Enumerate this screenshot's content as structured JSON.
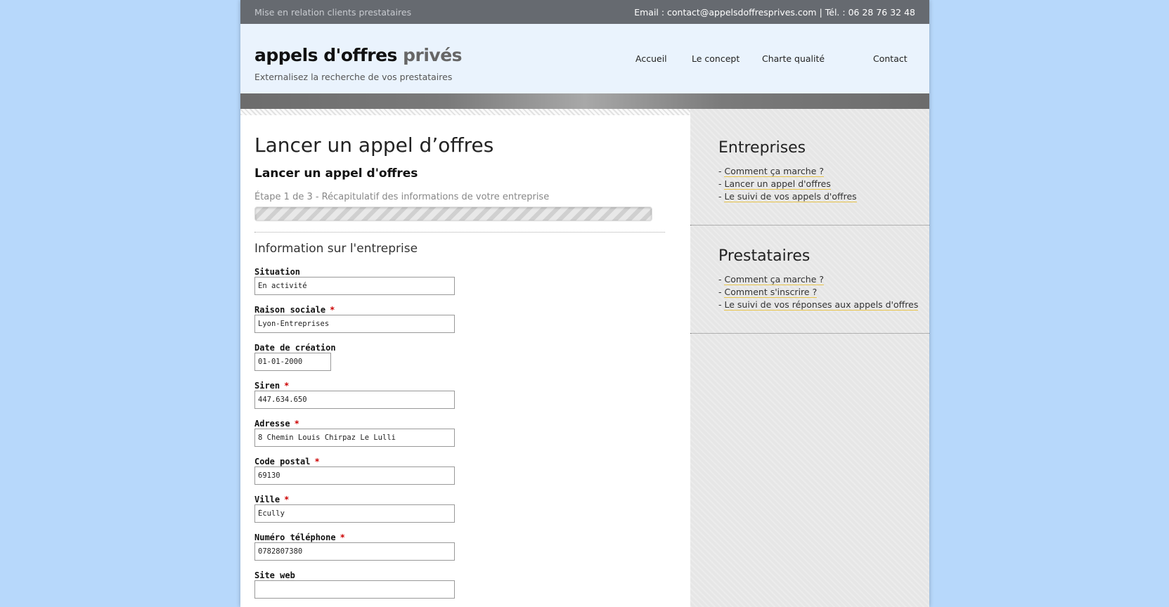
{
  "topbar": {
    "tagline": "Mise en relation clients prestataires",
    "contact": "Email : contact@appelsdoffresprives.com | Tél. : 06 28 76 32 48"
  },
  "header": {
    "logo_main": "appels d'offres",
    "logo_accent": "privés",
    "slogan": "Externalisez la recherche de vos prestataires",
    "nav": [
      "Accueil",
      "Le concept",
      "Charte qualité",
      "Contact"
    ]
  },
  "main": {
    "page_title": "Lancer un appel d’offres",
    "form_title": "Lancer un appel d'offres",
    "step_text": "Étape 1 de 3 - Récapitulatif des informations de votre entreprise",
    "section_title": "Information sur l'entreprise",
    "fields": [
      {
        "label": "Situation",
        "required": "",
        "value": "En activité"
      },
      {
        "label": "Raison sociale",
        "required": "*",
        "value": "Lyon-Entreprises"
      },
      {
        "label": "Date de création",
        "required": "",
        "value": "01-01-2000"
      },
      {
        "label": "Siren",
        "required": "*",
        "value": "447.634.650"
      },
      {
        "label": "Adresse",
        "required": "*",
        "value": "8 Chemin Louis Chirpaz Le Lulli"
      },
      {
        "label": "Code postal",
        "required": "*",
        "value": "69130"
      },
      {
        "label": "Ville",
        "required": "*",
        "value": "Écully"
      },
      {
        "label": "Numéro téléphone",
        "required": "*",
        "value": "0782807380"
      },
      {
        "label": "Site web",
        "required": "",
        "value": ""
      }
    ]
  },
  "sidebar": {
    "entreprises": {
      "title": "Entreprises",
      "links": [
        "Comment ça marche ?",
        "Lancer un appel d'offres",
        "Le suivi de vos appels d'offres"
      ]
    },
    "prestataires": {
      "title": "Prestataires",
      "links": [
        "Comment ça marche ?",
        "Comment s'inscrire ?",
        "Le suivi de vos réponses aux appels d'offres"
      ]
    }
  },
  "colors": {
    "background": "#b7d8fb",
    "topbar": "#666a70",
    "header": "#eaf3fd",
    "required": "#cc0000",
    "link_underline": "#e8c44a"
  }
}
